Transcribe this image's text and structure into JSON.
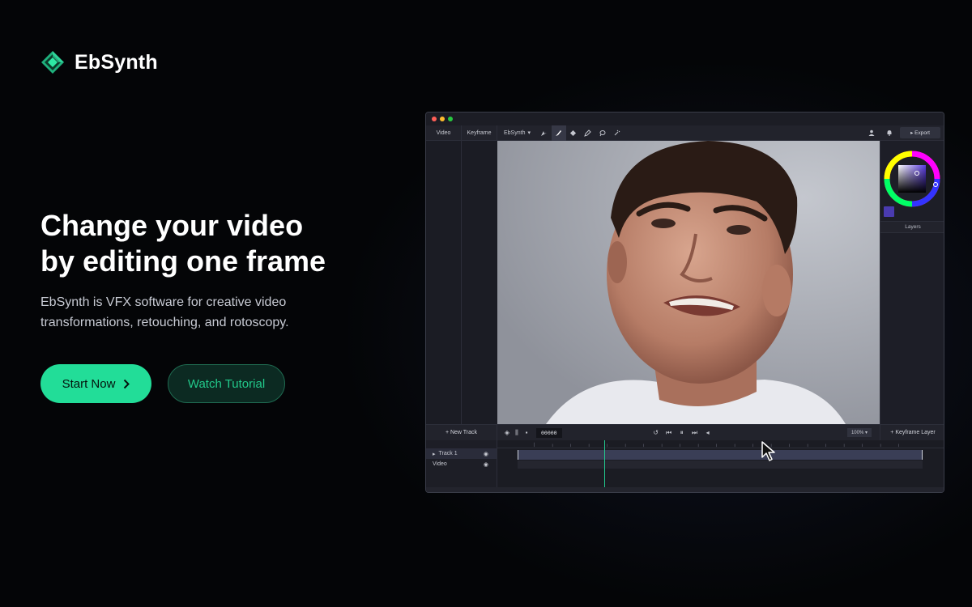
{
  "brand": {
    "name": "EbSynth",
    "accent": "#22dd98"
  },
  "hero": {
    "headline_line1": "Change your video",
    "headline_line2": "by editing one frame",
    "subtext_line1": "EbSynth is VFX software for creative video",
    "subtext_line2": "transformations, retouching, and rotoscopy."
  },
  "cta": {
    "primary_label": "Start Now",
    "primary_icon": "chevron-right-icon",
    "secondary_label": "Watch Tutorial"
  },
  "app": {
    "toolbar": {
      "video_tab": "Video",
      "keyframe_tab": "Keyframe",
      "engine_select": "EbSynth",
      "tools": [
        "move-icon",
        "brush-icon",
        "eraser-icon",
        "pen-icon",
        "lasso-icon",
        "wand-icon"
      ],
      "active_tool": "brush-icon",
      "export_label": "Export"
    },
    "right_panel": {
      "layers_label": "Layers",
      "current_color": "#4a3bb0"
    },
    "controls": {
      "new_track_label": "New Track",
      "frame_counter": "00000",
      "zoom_label": "100%",
      "keyframe_layer_label": "Keyframe Layer"
    },
    "timeline": {
      "tracks": [
        {
          "label": "Track 1"
        },
        {
          "label": "Video"
        }
      ]
    }
  }
}
